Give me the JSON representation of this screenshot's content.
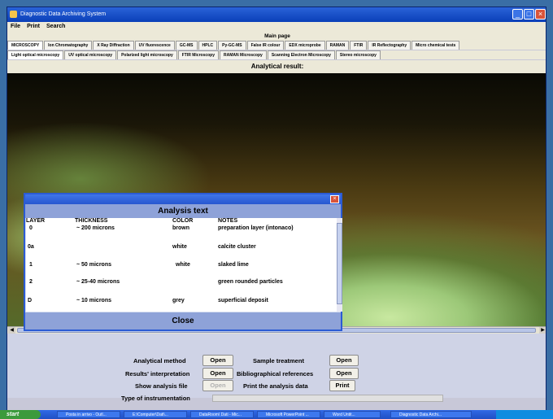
{
  "window": {
    "title": "Diagnostic Data Archiving System"
  },
  "menu": [
    "File",
    "Print",
    "Search"
  ],
  "main_page": "Main page",
  "tabs_primary": [
    "MICROSCOPY",
    "Ion Chromatography",
    "X Ray Diffraction",
    "UV fluorescence",
    "GC-MS",
    "HPLC",
    "Py-GC-MS",
    "False IR colour",
    "EDX microprobe",
    "RAMAN",
    "FTIR",
    "IR Reflectography",
    "Micro chemical tests"
  ],
  "tabs_secondary": [
    "Light optical microscopy",
    "UV optical microscopy",
    "Polarized light microscopy",
    "FTIR Microscopy",
    "RAMAN Microscopy",
    "Scanning Electron Microscopy",
    "Stereo microscopy"
  ],
  "analytical_result": "Analytical result:",
  "dialog": {
    "title": "Analysis text",
    "headers": {
      "layer": "LAYER",
      "thickness": "THICKNESS",
      "color": "COLOR",
      "notes": "NOTES"
    },
    "rows": [
      {
        "layer": "0",
        "thickness": "~ 200 microns",
        "color": "brown",
        "notes": "preparation layer (intonaco)"
      },
      {
        "layer": "0a",
        "thickness": "",
        "color": "white",
        "notes": "calcite cluster"
      },
      {
        "layer": "1",
        "thickness": "~ 50 microns",
        "color": "white",
        "notes": "slaked lime"
      },
      {
        "layer": "2",
        "thickness": "~ 25-40 microns",
        "color": "",
        "notes": "green        rounded particles"
      },
      {
        "layer": "D",
        "thickness": "~ 10 microns",
        "color": "grey",
        "notes": "superficial deposit"
      }
    ],
    "close": "Close"
  },
  "bottom": {
    "analytical_method": "Analytical method",
    "results_interpretation": "Results' interpretation",
    "show_analysis_file": "Show analysis file",
    "type_instrumentation": "Type of instrumentation",
    "sample_treatment": "Sample treatment",
    "bibliographical_references": "Bibliographical references",
    "print_analysis_data": "Print the analysis data",
    "open": "Open",
    "print": "Print"
  },
  "taskbar": {
    "start": "start",
    "tasks": [
      "Posta in arrivo - Outl...",
      "E:\\Computer\\Dati\\...",
      "DataRoom\\ Dati - Mic...",
      "Microsoft PowerPoint ...",
      "Word Untit...",
      "Diagnostic Data Archi..."
    ]
  }
}
